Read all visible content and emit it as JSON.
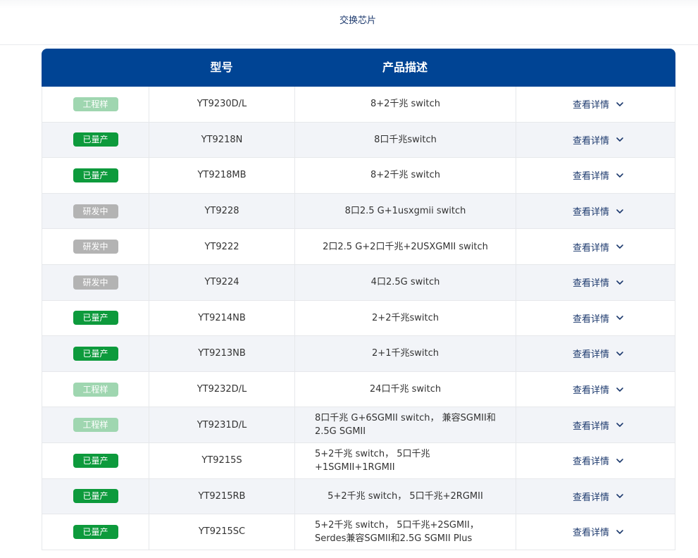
{
  "nav": {
    "tab_label": "交换芯片"
  },
  "table": {
    "headers": {
      "status": "",
      "model": "型号",
      "description": "产品描述",
      "action": ""
    },
    "detail_label": "查看详情",
    "status_styles": {
      "工程样": "eng",
      "已量产": "mass",
      "研发中": "dev"
    },
    "colors": {
      "header_bg": "#004494",
      "mass": "#0d9a3c",
      "engineering": "#9fd6b0",
      "developing": "#b3b3b3",
      "link": "#1d3a6e"
    },
    "rows": [
      {
        "status": "工程样",
        "model": "YT9230D/L",
        "description": "8+2千兆 switch"
      },
      {
        "status": "已量产",
        "model": "YT9218N",
        "description": "8口千兆switch"
      },
      {
        "status": "已量产",
        "model": "YT9218MB",
        "description": "8+2千兆 switch"
      },
      {
        "status": "研发中",
        "model": "YT9228",
        "description": "8口2.5 G+1usxgmii switch"
      },
      {
        "status": "研发中",
        "model": "YT9222",
        "description": "2口2.5 G+2口千兆+2USXGMII switch"
      },
      {
        "status": "研发中",
        "model": "YT9224",
        "description": "4口2.5G switch"
      },
      {
        "status": "已量产",
        "model": "YT9214NB",
        "description": "2+2千兆switch"
      },
      {
        "status": "已量产",
        "model": "YT9213NB",
        "description": "2+1千兆switch"
      },
      {
        "status": "工程样",
        "model": "YT9232D/L",
        "description": "24口千兆 switch"
      },
      {
        "status": "工程样",
        "model": "YT9231D/L",
        "description": "8口千兆 G+6SGMII switch， 兼容SGMII和2.5G SGMII",
        "wrap": true
      },
      {
        "status": "已量产",
        "model": "YT9215S",
        "description": "5+2千兆 switch， 5口千兆+1SGMII+1RGMII",
        "wrap": true
      },
      {
        "status": "已量产",
        "model": "YT9215RB",
        "description": "5+2千兆 switch， 5口千兆+2RGMII"
      },
      {
        "status": "已量产",
        "model": "YT9215SC",
        "description": "5+2千兆 switch， 5口千兆+2SGMII，Serdes兼容SGMII和2.5G SGMII Plus",
        "wrap": true
      }
    ]
  }
}
